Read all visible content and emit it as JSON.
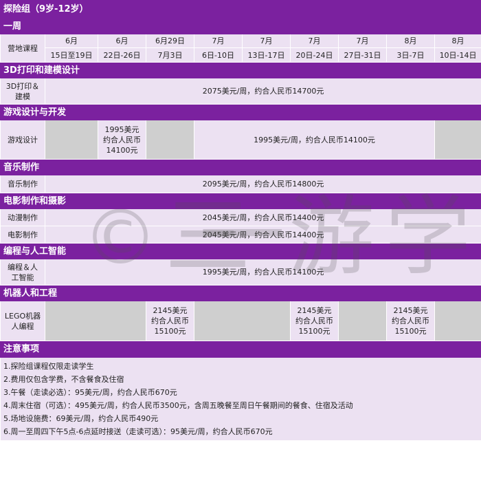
{
  "title": "探险组（9岁-12岁）",
  "duration": "一周",
  "weeks_label": "营地课程",
  "weeks": [
    {
      "month": "6月",
      "dates": "15日至19日"
    },
    {
      "month": "6月",
      "dates": "22日-26日"
    },
    {
      "month": "6月29日",
      "dates": "7月3日"
    },
    {
      "month": "7月",
      "dates": "6日-10日"
    },
    {
      "month": "7月",
      "dates": "13日-17日"
    },
    {
      "month": "7月",
      "dates": "20日-24日"
    },
    {
      "month": "7月",
      "dates": "27日-31日"
    },
    {
      "month": "8月",
      "dates": "3日-7日"
    },
    {
      "month": "8月",
      "dates": "10日-14日"
    }
  ],
  "sections": {
    "s3d": {
      "title": "3D打印和建模设计",
      "course_a": "3D打印＆",
      "course_b": "建模",
      "price": "2075美元/周，约合人民币14700元"
    },
    "game": {
      "title": "游戏设计与开发",
      "course": "游戏设计",
      "wk2_a": "1995美元",
      "wk2_b": "约合人民币",
      "wk2_c": "14100元",
      "price": "1995美元/周，约合人民币14100元"
    },
    "music": {
      "title": "音乐制作",
      "course": "音乐制作",
      "price": "2095美元/周，约合人民币14800元"
    },
    "film": {
      "title": "电影制作和摄影",
      "anim": "动漫制作",
      "anim_price": "2045美元/周，约合人民币14400元",
      "movie": "电影制作",
      "movie_price": "2045美元/周，约合人民币14400元"
    },
    "coding": {
      "title": "编程与人工智能",
      "course_a": "编程＆人",
      "course_b": "工智能",
      "price": "1995美元/周，约合人民币14100元"
    },
    "robot": {
      "title": "机器人和工程",
      "course_a": "LEGO机器",
      "course_b": "人编程",
      "cell_a": "2145美元",
      "cell_b": "约合人民币",
      "cell_c": "15100元"
    }
  },
  "notes": {
    "title": "注意事项",
    "items": [
      "1.探险组课程仅限走读学生",
      "2.费用仅包含学费，不含餐食及住宿",
      "3.午餐（走读必选）：95美元/周，约合人民币670元",
      "4.周末住宿（可选）：495美元/周，约合人民币3500元，含周五晚餐至周日午餐期间的餐食、住宿及活动",
      "5.场地设施费：69美元/周，约合人民币490元",
      "6.周一至周四下午5点-6点延时接送（走读可选）：95美元/周，约合人民币670元"
    ]
  },
  "watermark": [
    "©",
    "三",
    "一",
    "游",
    "学"
  ]
}
